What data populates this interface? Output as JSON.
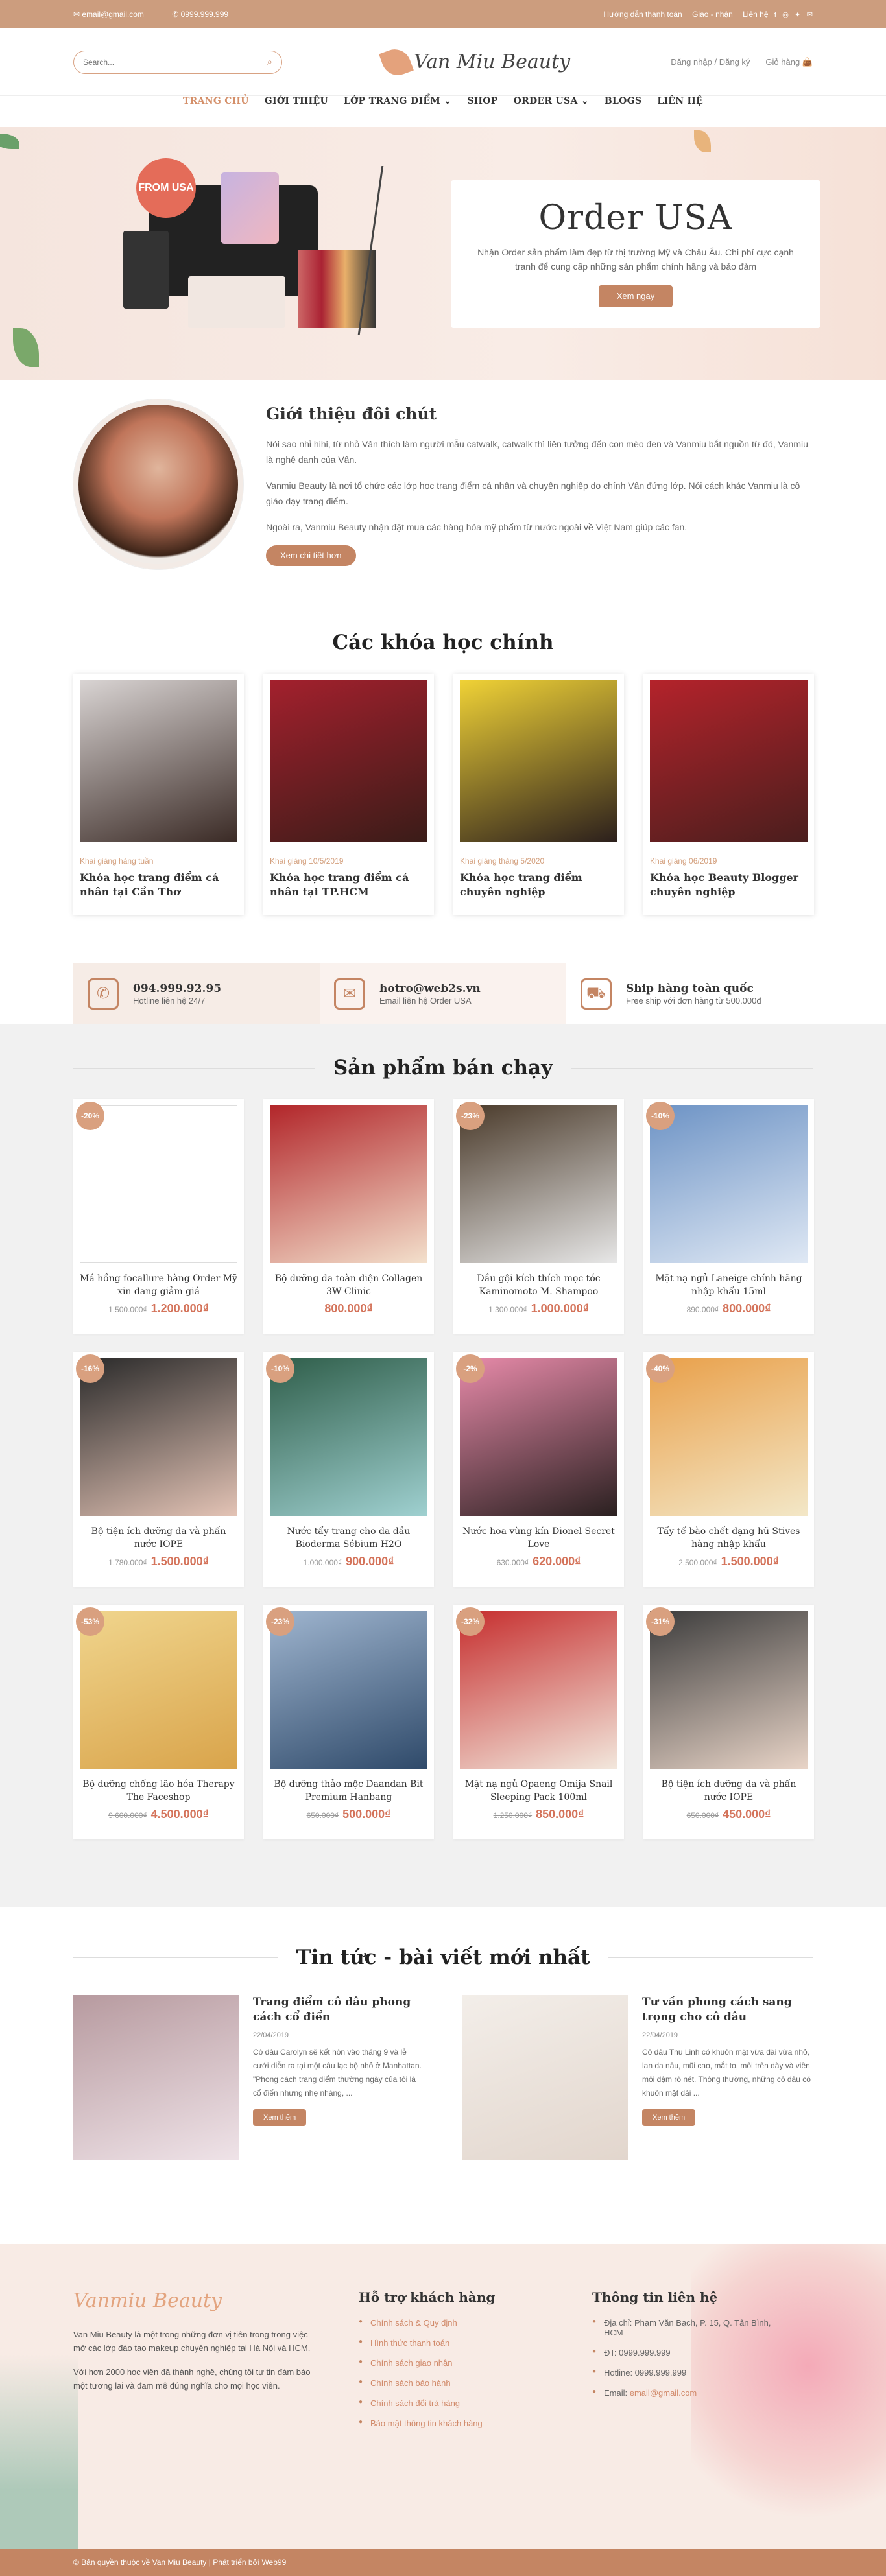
{
  "topbar": {
    "email": "email@gmail.com",
    "phone": "0999.999.999",
    "links": [
      "Hướng dẫn thanh toán",
      "Giao - nhận",
      "Liên hệ"
    ]
  },
  "header": {
    "search_placeholder": "Search...",
    "logo_text": "Van Miu Beauty",
    "login": "Đăng nhập / Đăng ký",
    "cart": "Giỏ hàng"
  },
  "nav": [
    "TRANG CHỦ",
    "GIỚI THIỆU",
    "LỚP TRANG ĐIỂM",
    "SHOP",
    "ORDER USA",
    "BLOGS",
    "LIÊN HỆ"
  ],
  "hero": {
    "badge": "FROM USA",
    "title": "Order USA",
    "text": "Nhận Order sản phẩm làm đẹp từ thị trường Mỹ và Châu Âu. Chi phí cực cạnh tranh để cung cấp những sản phẩm chính hãng và bảo đảm",
    "button": "Xem ngay"
  },
  "intro": {
    "title": "Giới thiệu đôi chút",
    "p1": "Nói sao nhỉ hihi, từ nhỏ Vân thích làm người mẫu catwalk, catwalk thì liên tưởng đến con mèo đen và Vanmiu bắt nguồn từ đó, Vanmiu là nghệ danh của Vân.",
    "p2": "Vanmiu Beauty là nơi tổ chức các lớp học trang điểm cá nhân và chuyên nghiệp do chính Vân đứng lớp. Nói cách khác Vanmiu là cô giáo dạy trang điểm.",
    "p3": "Ngoài ra, Vanmiu Beauty nhận đặt mua các hàng hóa mỹ phẩm từ nước ngoài về Việt Nam giúp các fan.",
    "button": "Xem chi tiết hơn"
  },
  "courses": {
    "title": "Các khóa học chính",
    "items": [
      {
        "meta": "Khai giảng hàng tuần",
        "title": "Khóa học trang điểm cá nhân tại Cần Thơ",
        "colors": [
          "#d9d4d3",
          "#3a2a25"
        ]
      },
      {
        "meta": "Khai giảng 10/5/2019",
        "title": "Khóa học trang điểm cá nhân tại TP.HCM",
        "colors": [
          "#a3202d",
          "#3a1c18"
        ]
      },
      {
        "meta": "Khai giảng tháng 5/2020",
        "title": "Khóa học trang điểm chuyên nghiệp",
        "colors": [
          "#f0d236",
          "#2b1f1c"
        ]
      },
      {
        "meta": "Khai giảng 06/2019",
        "title": "Khóa học Beauty Blogger chuyên nghiệp",
        "colors": [
          "#b4232b",
          "#4a1e1d"
        ]
      }
    ]
  },
  "strip": [
    {
      "icon": "phone-icon",
      "glyph": "✆",
      "title": "094.999.92.95",
      "sub": "Hotline liên hệ 24/7"
    },
    {
      "icon": "mail-icon",
      "glyph": "✉",
      "title": "hotro@web2s.vn",
      "sub": "Email liên hệ Order USA"
    },
    {
      "icon": "truck-icon",
      "glyph": "⛟",
      "title": "Ship hàng toàn quốc",
      "sub": "Free ship với đơn hàng từ 500.000đ"
    }
  ],
  "products": {
    "title": "Sản phẩm bán chạy",
    "items": [
      {
        "sale": "-20%",
        "name": "Má hồng focallure hàng Order Mỹ xin dang giảm giá",
        "old": "1.500.000₫",
        "price": "1.200.000₫",
        "colors": [
          "#ffffff",
          "#ffffff"
        ]
      },
      {
        "sale": "",
        "name": "Bộ dưỡng da toàn diện Collagen 3W Clinic",
        "old": "",
        "price": "800.000₫",
        "colors": [
          "#b2262a",
          "#f3e0cc"
        ]
      },
      {
        "sale": "-23%",
        "name": "Dầu gội kích thích mọc tóc Kaminomoto M. Shampoo",
        "old": "1.300.000₫",
        "price": "1.000.000₫",
        "colors": [
          "#4a3a2a",
          "#e7e7e7"
        ]
      },
      {
        "sale": "-10%",
        "name": "Mặt nạ ngủ Laneige chính hãng nhập khẩu 15ml",
        "old": "890.000₫",
        "price": "800.000₫",
        "colors": [
          "#6d93c5",
          "#dfe8f4"
        ]
      },
      {
        "sale": "-16%",
        "name": "Bộ tiện ích dưỡng da và phấn nước IOPE",
        "old": "1.780.000₫",
        "price": "1.500.000₫",
        "colors": [
          "#2a2a2a",
          "#e3c3b5"
        ]
      },
      {
        "sale": "-10%",
        "name": "Nước tẩy trang cho da dầu Bioderma Sébium H2O",
        "old": "1.000.000₫",
        "price": "900.000₫",
        "colors": [
          "#2f5e4a",
          "#9fd0d0"
        ]
      },
      {
        "sale": "-2%",
        "name": "Nước hoa vùng kín Dionel Secret Love",
        "old": "630.000₫",
        "price": "620.000₫",
        "colors": [
          "#e78aa9",
          "#2a2020"
        ]
      },
      {
        "sale": "-40%",
        "name": "Tẩy tế bào chết dạng hũ Stives hàng nhập khẩu",
        "old": "2.500.000₫",
        "price": "1.500.000₫",
        "colors": [
          "#e9a04a",
          "#f3e7c7"
        ]
      },
      {
        "sale": "-53%",
        "name": "Bộ dưỡng chống lão hóa Therapy The Faceshop",
        "old": "9.600.000₫",
        "price": "4.500.000₫",
        "colors": [
          "#f0d58d",
          "#d9a44b"
        ]
      },
      {
        "sale": "-23%",
        "name": "Bộ dưỡng thảo mộc Daandan Bit Premium Hanbang",
        "old": "650.000₫",
        "price": "500.000₫",
        "colors": [
          "#9fb5cf",
          "#2f4a6a"
        ]
      },
      {
        "sale": "-32%",
        "name": "Mặt nạ ngủ Opaeng Omija Snail Sleeping Pack 100ml",
        "old": "1.250.000₫",
        "price": "850.000₫",
        "colors": [
          "#c62e2e",
          "#f2e7dc"
        ]
      },
      {
        "sale": "-31%",
        "name": "Bộ tiện ích dưỡng da và phấn nước IOPE",
        "old": "650.000₫",
        "price": "450.000₫",
        "colors": [
          "#3c3c3c",
          "#e8d4c7"
        ]
      }
    ]
  },
  "news": {
    "title": "Tin tức - bài viết mới nhất",
    "items": [
      {
        "title": "Trang điểm cô dâu phong cách cổ điển",
        "date": "22/04/2019",
        "excerpt": "Cô dâu Carolyn sẽ kết hôn vào tháng 9 và lễ cưới diễn ra tại một câu lạc bộ nhỏ ở Manhattan. \"Phong cách trang điểm thường ngày của tôi là cổ điển nhưng nhẹ nhàng, ...",
        "button": "Xem thêm",
        "colors": [
          "#b79a9f",
          "#efe3e8"
        ]
      },
      {
        "title": "Tư vấn phong cách sang trọng cho cô dâu",
        "date": "22/04/2019",
        "excerpt": "Cô dâu Thu Linh có khuôn mặt vừa dài vừa nhỏ, lan da nâu, mũi cao, mắt to, môi trên dày và viền môi đậm rõ nét. Thông thường, những cô dâu có khuôn mặt dài ...",
        "button": "Xem thêm",
        "colors": [
          "#f3eee9",
          "#e2d6cd"
        ]
      }
    ]
  },
  "footer": {
    "logo": "Vanmiu Beauty",
    "about1": "Van Miu Beauty là một trong những đơn vị tiên trong trong việc mở các lớp đào tạo makeup chuyên nghiệp tại Hà Nội và HCM.",
    "about2": "Với hơn 2000 học viên đã thành nghề, chúng tôi tự tin đảm bảo một tương lai và đam mê đúng nghĩa cho mọi học viên.",
    "support_title": "Hỗ trợ khách hàng",
    "support": [
      "Chính sách & Quy định",
      "Hình thức thanh toán",
      "Chính sách giao nhận",
      "Chính sách bảo hành",
      "Chính sách đổi trả hàng",
      "Bảo mật thông tin khách hàng"
    ],
    "contact_title": "Thông tin liên hệ",
    "address": "Địa chỉ: Phạm Văn Bạch, P. 15, Q. Tân Bình, HCM",
    "phone": "ĐT: 0999.999.999",
    "hotline": "Hotline: 0999.999.999",
    "email_label": "Email:",
    "email": "email@gmail.com"
  },
  "copyright": "© Bản quyền thuộc về Van Miu Beauty  |  Phát triển bởi Web99"
}
